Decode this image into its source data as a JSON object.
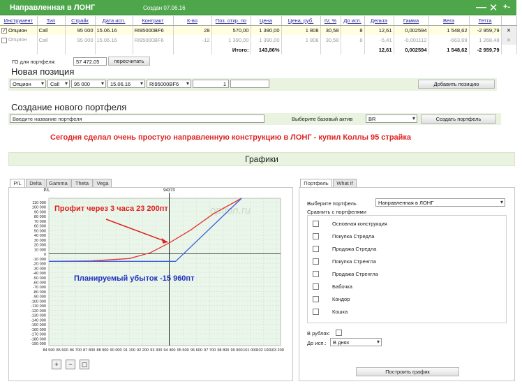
{
  "titlebar": {
    "title": "Направленная в ЛОНГ",
    "created": "Создан 07.06.16",
    "ctl_min": "—",
    "ctl_close": "✕",
    "ctl_add": "+-"
  },
  "table": {
    "headers": [
      "Инструмент",
      "Тип",
      "Страйк",
      "Дата исп.",
      "Контракт",
      "К-во",
      "Поз. откр. по",
      "Цена",
      "Цена, руб.",
      "IV, %",
      "До исп.",
      "Дельта",
      "Гамма",
      "Вега",
      "Тетта"
    ],
    "rows": [
      {
        "checked": "✓",
        "instrument": "Опцион",
        "type": "Call",
        "strike": "95 000",
        "date": "15.06.16",
        "contract": "RI95000BF6",
        "qty": "28",
        "open": "570,00",
        "price": "1 390,00",
        "price_rub": "1 808",
        "iv": "30,58",
        "days": "8",
        "delta": "12,61",
        "gamma": "0,002594",
        "vega": "1 548,62",
        "theta": "-2 959,79",
        "del": "✕"
      },
      {
        "checked": "",
        "instrument": "Опцион",
        "type": "Call",
        "strike": "95 000",
        "date": "15.06.16",
        "contract": "RI95000BF6",
        "qty": "-12",
        "open": "1 390,00",
        "price": "1 390,00",
        "price_rub": "1 808",
        "iv": "30,58",
        "days": "8",
        "delta": "-5,41",
        "gamma": "-0,001112",
        "vega": "-663,69",
        "theta": "1 268,48",
        "del": "✕"
      }
    ],
    "total_label": "Итого:",
    "total_pct": "143,86%",
    "total_delta": "12,61",
    "total_gamma": "0,002594",
    "total_vega": "1 548,62",
    "total_theta": "-2 959,79"
  },
  "go": {
    "label": "ГО для портфеля:",
    "value": "57 472,05",
    "recalc": "пересчитать"
  },
  "new_position": {
    "title": "Новая позиция",
    "instrument": "Опцион",
    "type": "Call",
    "strike": "95 000",
    "date": "15.06.16",
    "contract": "RI95000BF6",
    "qty": "1",
    "add_button": "Добавить позицию"
  },
  "new_portfolio": {
    "title": "Создание нового портфеля",
    "name_placeholder": "Введите название портфеля",
    "base_label": "Выберите базовый актив",
    "base_value": "BR",
    "create_button": "Создать портфель"
  },
  "annotation": "Сегодня сделал очень простую направленную конструкцию в ЛОНГ - купил Коллы 95 страйка",
  "graphs_header": "Графики",
  "graph_tabs": [
    "P/L",
    "Delta",
    "Gamma",
    "Theta",
    "Vega"
  ],
  "chart_data": {
    "type": "line",
    "ylabel": "P/L",
    "marker_label": "94370",
    "marker_x": 94370,
    "watermark": "option.ru",
    "xlim": [
      84500,
      103500
    ],
    "ylim": [
      -195000,
      118000
    ],
    "x_ticks": [
      84500,
      85600,
      86700,
      87800,
      88900,
      90000,
      91100,
      92200,
      93300,
      94400,
      95500,
      96600,
      97700,
      98800,
      99900,
      101000,
      102100,
      103200
    ],
    "x_tick_labels": [
      "84 500",
      "85 600",
      "86 700",
      "87 800",
      "88 900",
      "90 000",
      "91 100",
      "92 200",
      "93 300",
      "94 400",
      "95 500",
      "96 600",
      "97 700",
      "98 800",
      "99 900",
      "101 000",
      "102 100",
      "103 200"
    ],
    "y_ticks": [
      110000,
      100000,
      90000,
      80000,
      70000,
      60000,
      50000,
      40000,
      30000,
      20000,
      10000,
      0,
      -10000,
      -20000,
      -30000,
      -40000,
      -50000,
      -60000,
      -70000,
      -80000,
      -90000,
      -100000,
      -110000,
      -120000,
      -130000,
      -140000,
      -150000,
      -160000,
      -170000,
      -180000,
      -190000
    ],
    "y_tick_labels": [
      "110 000",
      "100 000",
      "90 000",
      "80 000",
      "70 000",
      "60 000",
      "50 000",
      "40 000",
      "30 000",
      "20 000",
      "10 000",
      "0",
      "-10 000",
      "-20 000",
      "-30 000",
      "-40 000",
      "-50 000",
      "-60 000",
      "-70 000",
      "-80 000",
      "-90 000",
      "-100 000",
      "-110 000",
      "-120 000",
      "-130 000",
      "-140 000",
      "-150 000",
      "-160 000",
      "-170 000",
      "-180 000",
      "-190 000"
    ],
    "series": [
      {
        "color": "#e83030",
        "x": [
          84500,
          88000,
          91100,
          92800,
          94370,
          96100,
          98000,
          100300
        ],
        "y": [
          -15960,
          -15000,
          -10000,
          2000,
          23200,
          50000,
          85000,
          118000
        ]
      },
      {
        "color": "#3a5be0",
        "x": [
          84500,
          94900,
          100300
        ],
        "y": [
          -15960,
          -15960,
          118000
        ]
      }
    ],
    "annotations": [
      {
        "text": "Профит через 3 часа  23 200пт",
        "color": "#e02020"
      },
      {
        "text": "Планируемый убыток  -15 960пт",
        "color": "#2030c0"
      }
    ]
  },
  "right_panel": {
    "tabs": [
      "Портфель",
      "What if"
    ],
    "portfolio_label": "Выберите портфель",
    "portfolio_value": "Направленная в ЛОНГ",
    "compare_label": "Сравнить с портфелями",
    "portfolios": [
      "Основная конструкция",
      "Покупка Стредла",
      "Продажа Стредла",
      "Покупка Стренгла",
      "Продажа Стренгла",
      "Бабочка",
      "Кондор",
      "Кошка"
    ],
    "rub_label": "В рублях:",
    "exp_label": "До исп.:",
    "exp_value": "В днях",
    "build_button": "Построить график"
  },
  "colors": {
    "green": "#4ea64b",
    "light_green": "#e9f3e0",
    "red_text": "#e02020"
  }
}
